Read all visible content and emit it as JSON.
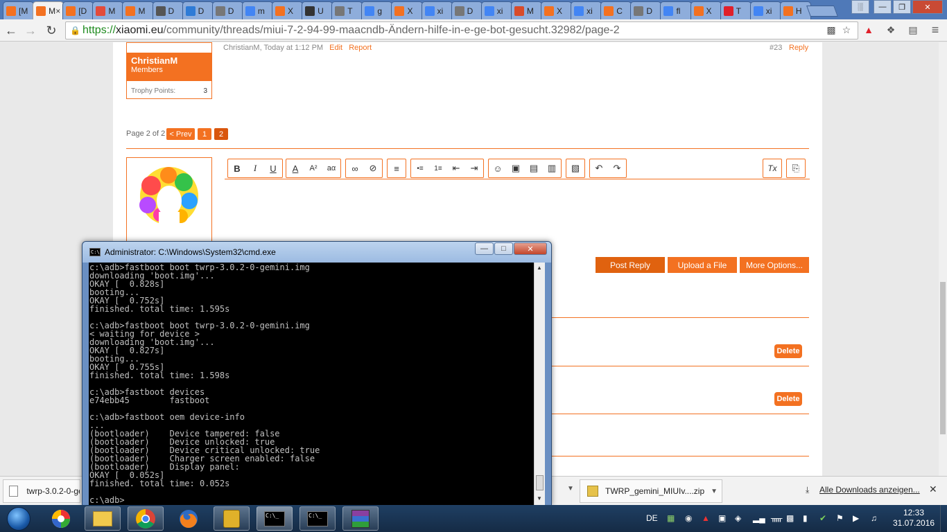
{
  "browser": {
    "tabs": [
      {
        "label": "[M",
        "icon": "miui",
        "color": "#f37121",
        "active": false
      },
      {
        "label": "M",
        "icon": "miui-page",
        "color": "#f37121",
        "active": true
      },
      {
        "label": "[D",
        "icon": "miui",
        "color": "#f37121",
        "active": false
      },
      {
        "label": "M",
        "icon": "image",
        "color": "#e24b3b",
        "active": false
      },
      {
        "label": "M",
        "icon": "mi",
        "color": "#f37121",
        "active": false
      },
      {
        "label": "D",
        "icon": "download",
        "color": "#555555",
        "active": false
      },
      {
        "label": "D",
        "icon": "bolt",
        "color": "#2e7bd6",
        "active": false
      },
      {
        "label": "D",
        "icon": "doc",
        "color": "#777777",
        "active": false
      },
      {
        "label": "m",
        "icon": "google",
        "color": "#4285f4",
        "active": false
      },
      {
        "label": "X",
        "icon": "miui",
        "color": "#f37121",
        "active": false
      },
      {
        "label": "U",
        "icon": "linux",
        "color": "#333333",
        "active": false
      },
      {
        "label": "T",
        "icon": "doc",
        "color": "#777777",
        "active": false
      },
      {
        "label": "g",
        "icon": "google",
        "color": "#4285f4",
        "active": false
      },
      {
        "label": "X",
        "icon": "mi",
        "color": "#f37121",
        "active": false
      },
      {
        "label": "xi",
        "icon": "google",
        "color": "#4285f4",
        "active": false
      },
      {
        "label": "D",
        "icon": "doc",
        "color": "#777777",
        "active": false
      },
      {
        "label": "xi",
        "icon": "google",
        "color": "#4285f4",
        "active": false
      },
      {
        "label": "M",
        "icon": "mi",
        "color": "#d84b2a",
        "active": false
      },
      {
        "label": "X",
        "icon": "miui",
        "color": "#f37121",
        "active": false
      },
      {
        "label": "xi",
        "icon": "google",
        "color": "#4285f4",
        "active": false
      },
      {
        "label": "C",
        "icon": "miui",
        "color": "#f37121",
        "active": false
      },
      {
        "label": "D",
        "icon": "doc",
        "color": "#777777",
        "active": false
      },
      {
        "label": "fl",
        "icon": "google",
        "color": "#4285f4",
        "active": false
      },
      {
        "label": "X",
        "icon": "miui",
        "color": "#f37121",
        "active": false
      },
      {
        "label": "T",
        "icon": "oneplus",
        "color": "#e0202a",
        "active": false
      },
      {
        "label": "xi",
        "icon": "google",
        "color": "#4285f4",
        "active": false
      },
      {
        "label": "H",
        "icon": "miui",
        "color": "#f37121",
        "active": false
      }
    ],
    "url": {
      "scheme": "https://",
      "host": "xiaomi.eu",
      "path": "/community/threads/miui-7-2-94-99-maacndb-Ändern-hilfe-in-e-ge-bot-gesucht.32982/page-2"
    }
  },
  "post": {
    "user_name": "ChristianM",
    "user_role": "Members",
    "trophy_label": "Trophy Points:",
    "trophy_value": "3",
    "meta_author": "ChristianM, Today at 1:12 PM",
    "edit_label": "Edit",
    "report_label": "Report",
    "post_number": "#23",
    "reply_label": "Reply"
  },
  "pagination": {
    "label": "Page 2 of 2",
    "prev": "< Prev",
    "pages": [
      "1",
      "2"
    ]
  },
  "editor": {
    "buttons": [
      "B",
      "I",
      "U",
      "A",
      "A²",
      "aα",
      "∞",
      "⊘",
      "≡",
      "•≡",
      "1≡",
      "⇤",
      "⇥",
      "☺",
      "▣",
      "▤",
      "▥",
      "▧",
      "↶",
      "↷",
      "Tx",
      "⎘"
    ],
    "post_reply": "Post Reply",
    "upload_file": "Upload a File",
    "more_options": "More Options..."
  },
  "delete_label": "Delete",
  "cmd": {
    "title": "Administrator: C:\\Windows\\System32\\cmd.exe",
    "lines": [
      "c:\\adb>fastboot boot twrp-3.0.2-0-gemini.img",
      "downloading 'boot.img'...",
      "OKAY [  0.828s]",
      "booting...",
      "OKAY [  0.752s]",
      "finished. total time: 1.595s",
      "",
      "c:\\adb>fastboot boot twrp-3.0.2-0-gemini.img",
      "< waiting for device >",
      "downloading 'boot.img'...",
      "OKAY [  0.827s]",
      "booting...",
      "OKAY [  0.755s]",
      "finished. total time: 1.598s",
      "",
      "c:\\adb>fastboot devices",
      "e74ebb45        fastboot",
      "",
      "c:\\adb>fastboot oem device-info",
      "...",
      "(bootloader)    Device tampered: false",
      "(bootloader)    Device unlocked: true",
      "(bootloader)    Device critical unlocked: true",
      "(bootloader)    Charger screen enabled: false",
      "(bootloader)    Display panel:",
      "OKAY [  0.052s]",
      "finished. total time: 0.052s",
      "",
      "c:\\adb>"
    ]
  },
  "downloads": {
    "item1": "twrp-3.0.2-0-ge",
    "item2": "TWRP_gemini_MIUIv....zip",
    "show_all": "Alle Downloads anzeigen..."
  },
  "taskbar": {
    "language": "DE",
    "time": "12:33",
    "date": "31.07.2016"
  },
  "colors": {
    "accent": "#f37121",
    "taskbar": "#1f3f63"
  }
}
